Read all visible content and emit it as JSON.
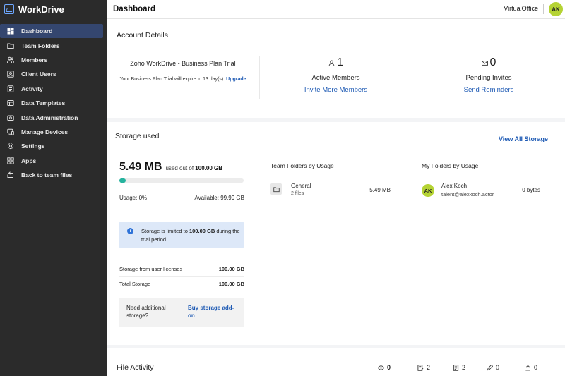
{
  "app": {
    "name": "WorkDrive"
  },
  "sidebar": {
    "items": [
      {
        "label": "Dashboard",
        "icon": "dashboard-icon",
        "active": true
      },
      {
        "label": "Team Folders",
        "icon": "team-folders-icon"
      },
      {
        "label": "Members",
        "icon": "members-icon"
      },
      {
        "label": "Client Users",
        "icon": "client-users-icon"
      },
      {
        "label": "Activity",
        "icon": "activity-icon"
      },
      {
        "label": "Data Templates",
        "icon": "data-templates-icon"
      },
      {
        "label": "Data Administration",
        "icon": "data-administration-icon"
      },
      {
        "label": "Manage Devices",
        "icon": "manage-devices-icon"
      },
      {
        "label": "Settings",
        "icon": "gear-icon"
      },
      {
        "label": "Apps",
        "icon": "apps-icon"
      },
      {
        "label": "Back to team files",
        "icon": "back-arrow-icon"
      }
    ]
  },
  "header": {
    "title": "Dashboard",
    "org_name": "VirtualOffice",
    "avatar_initials": "AK"
  },
  "account": {
    "title": "Account Details",
    "plan_name": "Zoho WorkDrive - Business Plan Trial",
    "plan_expiry": "Your Business Plan Trial will expire in 13 day(s).",
    "upgrade_label": "Upgrade",
    "active_members_count": "1",
    "active_members_label": "Active Members",
    "invite_label": "Invite More Members",
    "pending_invites_count": "0",
    "pending_invites_label": "Pending Invites",
    "reminders_label": "Send Reminders"
  },
  "storage": {
    "title": "Storage used",
    "view_all_label": "View All Storage",
    "used_value": "5.49 MB",
    "used_of_prefix": "used out of",
    "total_value": "100.00 GB",
    "usage_fraction": 0.05,
    "usage_label": "Usage: 0%",
    "available_label": "Available: 99.99 GB",
    "info_prefix": "Storage is limited to",
    "info_amount": "100.00 GB",
    "info_suffix": "during the trial period.",
    "licenses_label": "Storage from user licenses",
    "licenses_value": "100.00 GB",
    "total_label": "Total Storage",
    "total_storage_value": "100.00 GB",
    "need_more": "Need additional storage?",
    "buy_addon": "Buy storage add-on",
    "team_folders_heading": "Team Folders by Usage",
    "my_folders_heading": "My Folders by Usage",
    "team_folder": {
      "name": "General",
      "files": "2 files",
      "size": "5.49 MB"
    },
    "my_folder_user": {
      "initials": "AK",
      "name": "Alex Koch",
      "email": "talent@alexkoch.actor",
      "size": "0 bytes"
    }
  },
  "activity": {
    "title": "File Activity",
    "stats": [
      {
        "icon": "eye-icon",
        "value": "0"
      },
      {
        "icon": "document-edit-icon",
        "value": "2"
      },
      {
        "icon": "document-icon",
        "value": "2"
      },
      {
        "icon": "pencil-icon",
        "value": "0"
      },
      {
        "icon": "upload-icon",
        "value": "0"
      }
    ]
  },
  "colors": {
    "sidebar_bg": "#2b2b2b",
    "sidebar_active": "#34466f",
    "link": "#1e5ab4",
    "progress": "#25b39e",
    "avatar": "#b5d334",
    "info_bg": "#dde8f8"
  }
}
